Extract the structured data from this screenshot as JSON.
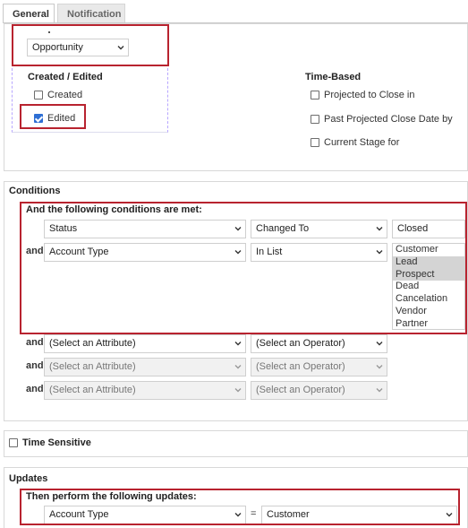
{
  "tabs": [
    {
      "label": "General",
      "active": true
    },
    {
      "label": "Notification",
      "active": false
    }
  ],
  "entity_select": {
    "value": "Opportunity"
  },
  "created_edited": {
    "title": "Created / Edited",
    "created": {
      "label": "Created",
      "checked": false
    },
    "edited": {
      "label": "Edited",
      "checked": true
    }
  },
  "time_based": {
    "title": "Time-Based",
    "options": [
      {
        "label": "Projected to Close in",
        "checked": false
      },
      {
        "label": "Past Projected Close Date by",
        "checked": false
      },
      {
        "label": "Current Stage for",
        "checked": false
      }
    ]
  },
  "conditions": {
    "title": "Conditions",
    "subtitle": "And the following conditions are met:",
    "rows": [
      {
        "prefix": "",
        "attribute": "Status",
        "operator": "Changed To",
        "value": "Closed"
      },
      {
        "prefix": "and",
        "attribute": "Account Type",
        "operator": "In List"
      },
      {
        "prefix": "and",
        "attribute": "(Select an Attribute)",
        "operator": "(Select an Operator)"
      },
      {
        "prefix": "and",
        "attribute": "(Select an Attribute)",
        "operator": "(Select an Operator)"
      },
      {
        "prefix": "and",
        "attribute": "(Select an Attribute)",
        "operator": "(Select an Operator)"
      }
    ],
    "list_options": [
      {
        "label": "Customer",
        "selected": false
      },
      {
        "label": "Lead",
        "selected": true
      },
      {
        "label": "Prospect",
        "selected": true
      },
      {
        "label": "Dead",
        "selected": false
      },
      {
        "label": "Cancelation",
        "selected": false
      },
      {
        "label": "Vendor",
        "selected": false
      },
      {
        "label": "Partner",
        "selected": false
      }
    ]
  },
  "time_sensitive": {
    "label": "Time Sensitive",
    "checked": false
  },
  "updates": {
    "title": "Updates",
    "subtitle": "Then perform the following updates:",
    "attribute": "Account Type",
    "equals": "=",
    "value": "Customer"
  },
  "colors": {
    "highlight_border": "#b8232f",
    "checkbox_checked": "#2f6fd4",
    "list_selected": "#d4d4d4"
  }
}
